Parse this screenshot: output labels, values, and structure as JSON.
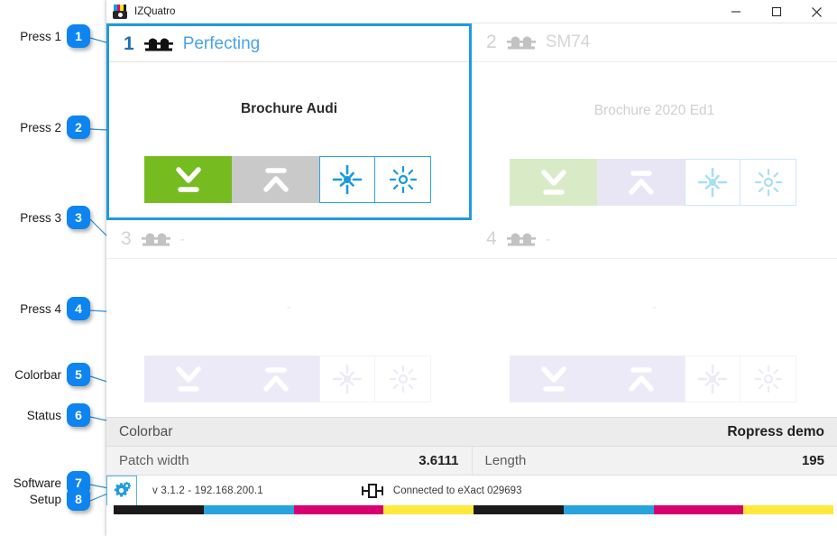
{
  "window": {
    "title": "IZQuatro",
    "app_icon": "printer-camera-icon",
    "icon_bar_colors": [
      "#00a0e3",
      "#e6007e",
      "#ffe700",
      "#1a1a1a"
    ],
    "controls": [
      {
        "name": "minimize",
        "glyph": "minimize-icon"
      },
      {
        "name": "maximize",
        "glyph": "maximize-icon"
      },
      {
        "name": "close",
        "glyph": "close-icon"
      }
    ]
  },
  "accent": "#1f9ae0",
  "presses": [
    {
      "number": "1",
      "name": "Perfecting",
      "job": "Brochure Audi",
      "selected": true,
      "state": "active",
      "buttons": [
        {
          "name": "measure-down-button",
          "icon": "arrow-down-to-line-icon",
          "style": "green"
        },
        {
          "name": "measure-up-button",
          "icon": "arrow-up-to-line-icon",
          "style": "grey"
        },
        {
          "name": "register-button",
          "icon": "registration-target-icon",
          "style": "outline"
        },
        {
          "name": "density-button",
          "icon": "density-sun-icon",
          "style": "outline"
        }
      ]
    },
    {
      "number": "2",
      "name": "SM74",
      "job": "Brochure 2020 Ed1",
      "selected": false,
      "state": "dim",
      "buttons": [
        {
          "name": "measure-down-button",
          "icon": "arrow-down-to-line-icon",
          "style": "green-dim"
        },
        {
          "name": "measure-up-button",
          "icon": "arrow-up-to-line-icon",
          "style": "grey-dim"
        },
        {
          "name": "register-button",
          "icon": "registration-target-icon",
          "style": "outline-dim"
        },
        {
          "name": "density-button",
          "icon": "density-sun-icon",
          "style": "outline-dim"
        }
      ]
    },
    {
      "number": "3",
      "name": "-",
      "job": "-",
      "selected": false,
      "state": "faint",
      "buttons": [
        {
          "name": "measure-down-button",
          "icon": "arrow-down-to-line-icon",
          "style": "green-faint"
        },
        {
          "name": "measure-up-button",
          "icon": "arrow-up-to-line-icon",
          "style": "grey-faint"
        },
        {
          "name": "register-button",
          "icon": "registration-target-icon",
          "style": "outline-faint"
        },
        {
          "name": "density-button",
          "icon": "density-sun-icon",
          "style": "outline-faint"
        }
      ]
    },
    {
      "number": "4",
      "name": "-",
      "job": "-",
      "selected": false,
      "state": "faint",
      "buttons": [
        {
          "name": "measure-down-button",
          "icon": "arrow-down-to-line-icon",
          "style": "green-faint"
        },
        {
          "name": "measure-up-button",
          "icon": "arrow-up-to-line-icon",
          "style": "grey-faint"
        },
        {
          "name": "register-button",
          "icon": "registration-target-icon",
          "style": "outline-faint"
        },
        {
          "name": "density-button",
          "icon": "density-sun-icon",
          "style": "outline-faint"
        }
      ]
    }
  ],
  "colorbar": {
    "title": "Colorbar",
    "preset": "Ropress demo",
    "fields": [
      {
        "label": "Patch width",
        "value": "3.6111"
      },
      {
        "label": "Length",
        "value": "195"
      }
    ]
  },
  "software": {
    "gear_icon": "gear-icon",
    "version": "v 3.1.2 - 192.168.200.1",
    "device_icon": "device-connector-icon",
    "device_status": "Connected to eXact 029693"
  },
  "cmyk_strip": [
    "#1a1a1a",
    "#29a3dc",
    "#d6006e",
    "#ffe93d",
    "#1a1a1a",
    "#29a3dc",
    "#d6006e",
    "#ffe93d"
  ],
  "annotations": [
    {
      "label": "Press 1",
      "number": "1"
    },
    {
      "label": "Press 2",
      "number": "2"
    },
    {
      "label": "Press 3",
      "number": "3"
    },
    {
      "label": "Press 4",
      "number": "4"
    },
    {
      "label": "Colorbar",
      "number": "5"
    },
    {
      "label": "Status",
      "number": "6"
    },
    {
      "label": "Software",
      "number": "7"
    },
    {
      "label": "Setup",
      "number": "8"
    }
  ]
}
